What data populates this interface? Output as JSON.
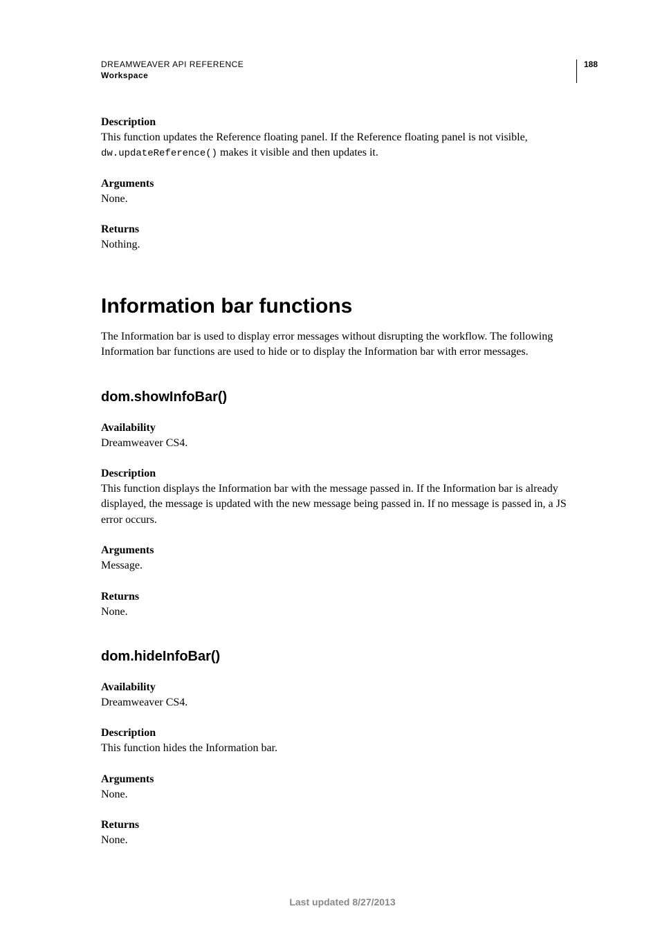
{
  "header": {
    "title": "DREAMWEAVER API REFERENCE",
    "section": "Workspace",
    "page_number": "188"
  },
  "block1": {
    "desc_label": "Description",
    "desc_text_before": "This function updates the Reference floating panel. If the Reference floating panel is not visible, ",
    "desc_code": "dw.updateReference()",
    "desc_text_after": " makes it visible and then updates it.",
    "args_label": "Arguments",
    "args_text": "None.",
    "returns_label": "Returns",
    "returns_text": "Nothing."
  },
  "section_title": "Information bar functions",
  "section_intro": "The Information bar is used to display error messages without disrupting the workflow. The following Information bar functions are used to hide or to display the Information bar with error messages.",
  "func1": {
    "title": "dom.showInfoBar()",
    "avail_label": "Availability",
    "avail_text": "Dreamweaver CS4.",
    "desc_label": "Description",
    "desc_text": "This function displays the Information bar with the message passed in. If the Information bar is already displayed, the message is updated with the new message being passed in. If no message is passed in, a JS error occurs.",
    "args_label": "Arguments",
    "args_text": "Message.",
    "returns_label": "Returns",
    "returns_text": "None."
  },
  "func2": {
    "title": "dom.hideInfoBar()",
    "avail_label": "Availability",
    "avail_text": "Dreamweaver CS4.",
    "desc_label": "Description",
    "desc_text": "This function hides the Information bar.",
    "args_label": "Arguments",
    "args_text": "None.",
    "returns_label": "Returns",
    "returns_text": "None."
  },
  "footer": "Last updated 8/27/2013"
}
